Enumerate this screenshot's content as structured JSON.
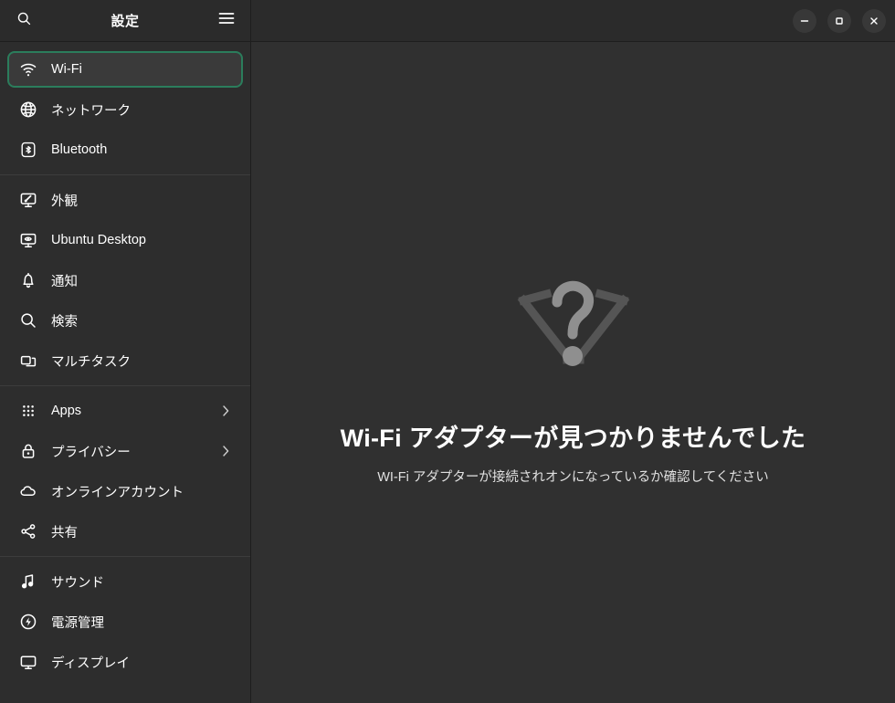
{
  "window": {
    "title": "設定",
    "controls": {
      "minimize_label": "−",
      "maximize_label": "□",
      "close_label": "×"
    }
  },
  "header": {
    "search_icon": "search-icon",
    "menu_icon": "hamburger-menu-icon"
  },
  "sidebar": {
    "groups": [
      {
        "items": [
          {
            "label": "Wi-Fi",
            "icon": "wifi-icon",
            "selected": true,
            "chevron": false
          },
          {
            "label": "ネットワーク",
            "icon": "network-globe-icon",
            "selected": false,
            "chevron": false
          },
          {
            "label": "Bluetooth",
            "icon": "bluetooth-icon",
            "selected": false,
            "chevron": false
          }
        ]
      },
      {
        "items": [
          {
            "label": "外観",
            "icon": "appearance-icon",
            "selected": false,
            "chevron": false
          },
          {
            "label": "Ubuntu Desktop",
            "icon": "ubuntu-desktop-icon",
            "selected": false,
            "chevron": false
          },
          {
            "label": "通知",
            "icon": "notifications-bell-icon",
            "selected": false,
            "chevron": false
          },
          {
            "label": "検索",
            "icon": "search-icon",
            "selected": false,
            "chevron": false
          },
          {
            "label": "マルチタスク",
            "icon": "multitasking-icon",
            "selected": false,
            "chevron": false
          }
        ]
      },
      {
        "items": [
          {
            "label": "Apps",
            "icon": "apps-grid-icon",
            "selected": false,
            "chevron": true
          },
          {
            "label": "プライバシー",
            "icon": "privacy-lock-icon",
            "selected": false,
            "chevron": true
          },
          {
            "label": "オンラインアカウント",
            "icon": "cloud-icon",
            "selected": false,
            "chevron": false
          },
          {
            "label": "共有",
            "icon": "sharing-icon",
            "selected": false,
            "chevron": false
          }
        ]
      },
      {
        "items": [
          {
            "label": "サウンド",
            "icon": "sound-note-icon",
            "selected": false,
            "chevron": false
          },
          {
            "label": "電源管理",
            "icon": "power-icon",
            "selected": false,
            "chevron": false
          },
          {
            "label": "ディスプレイ",
            "icon": "display-monitor-icon",
            "selected": false,
            "chevron": false
          }
        ]
      }
    ]
  },
  "main": {
    "empty_state": {
      "icon": "wifi-not-found-icon",
      "title": "Wi-Fi アダプターが見つかりませんでした",
      "subtitle": "WI-Fi アダプターが接続されオンになっているか確認してください"
    }
  },
  "colors": {
    "accent_green": "#2b7d5c",
    "header_bg": "#2b2b2b",
    "sidebar_bg": "#2d2d2d",
    "content_bg": "#303030",
    "selected_row_bg": "#3a3a3a",
    "empty_icon_gray": "#8c8c8c",
    "empty_icon_dark": "#555555"
  }
}
